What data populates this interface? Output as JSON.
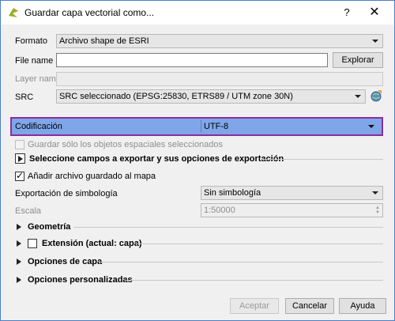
{
  "window": {
    "title": "Guardar capa vectorial como...",
    "help_glyph": "?",
    "close_glyph": "✕"
  },
  "fields": {
    "formato_label": "Formato",
    "formato_value": "Archivo shape de ESRI",
    "filename_label": "File name",
    "filename_value": "",
    "explorar_label": "Explorar",
    "layername_label": "Layer name",
    "layername_value": "",
    "src_label": "SRC",
    "src_value": "SRC seleccionado (EPSG:25830, ETRS89 / UTM zone 30N)",
    "codificacion_label": "Codificación",
    "codificacion_value": "UTF-8"
  },
  "options": {
    "solo_seleccionados_label": "Guardar sólo los objetos espaciales seleccionados",
    "solo_seleccionados_checked": false,
    "campos_section_label": "Seleccione campos a exportar y sus opciones de exportación",
    "anadir_mapa_label": "Añadir archivo guardado al mapa",
    "anadir_mapa_checked": true,
    "simbologia_label": "Exportación de simbología",
    "simbologia_value": "Sin simbología",
    "escala_label": "Escala",
    "escala_value": "1:50000"
  },
  "sections": {
    "geometria": "Geometría",
    "extension": "Extensión (actual: capa)",
    "opciones_capa": "Opciones de capa",
    "opciones_personalizadas": "Opciones personalizadas"
  },
  "buttons": {
    "aceptar": "Aceptar",
    "cancelar": "Cancelar",
    "ayuda": "Ayuda"
  },
  "colors": {
    "highlight": "#7fa6e8",
    "highlight_border": "#8a2d9c",
    "window_border": "#4a7fc8"
  },
  "icons": {
    "app": "qgis-icon",
    "crs": "crs-selector-icon"
  }
}
